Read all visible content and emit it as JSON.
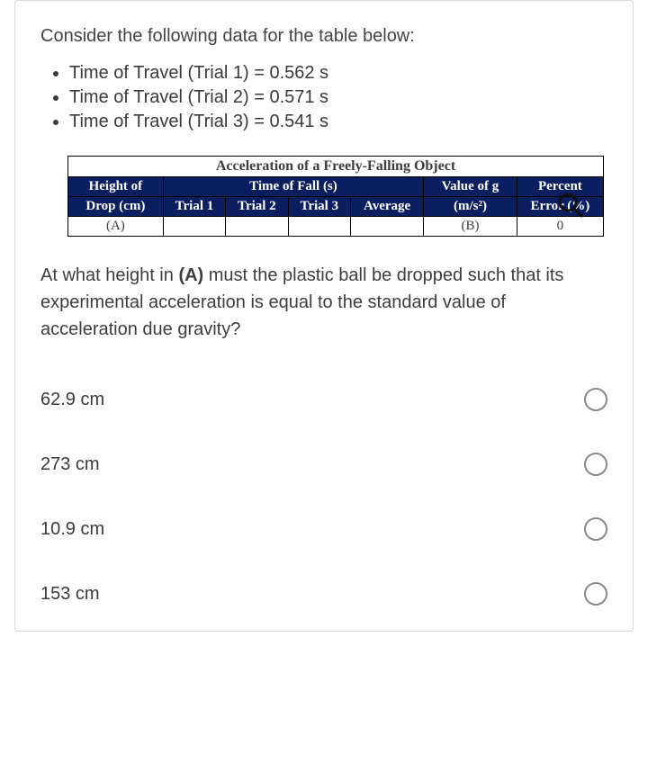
{
  "intro": "Consider the following data for the table below:",
  "data_list": [
    "Time of Travel (Trial 1) = 0.562 s",
    "Time of Travel (Trial 2) = 0.571 s",
    "Time of Travel (Trial 3) = 0.541 s"
  ],
  "table": {
    "caption": "Acceleration of a Freely-Falling Object",
    "headers": {
      "height_l1": "Height of",
      "height_l2": "Drop (cm)",
      "time_group": "Time of Fall (s)",
      "trial1": "Trial 1",
      "trial2": "Trial 2",
      "trial3": "Trial 3",
      "average": "Average",
      "value_l1": "Value of g",
      "value_l2": "(m/s²)",
      "percent_l1": "Percent",
      "percent_l2": "Error (%)"
    },
    "row": {
      "a": "(A)",
      "t1": "",
      "t2": "",
      "t3": "",
      "avg": "",
      "b": "(B)",
      "err": "0"
    }
  },
  "question": "At what height in (A) must the plastic ball be dropped such that its experimental acceleration is equal to the standard value of acceleration due gravity?",
  "options": [
    "62.9 cm",
    "273 cm",
    "10.9 cm",
    "153 cm"
  ]
}
